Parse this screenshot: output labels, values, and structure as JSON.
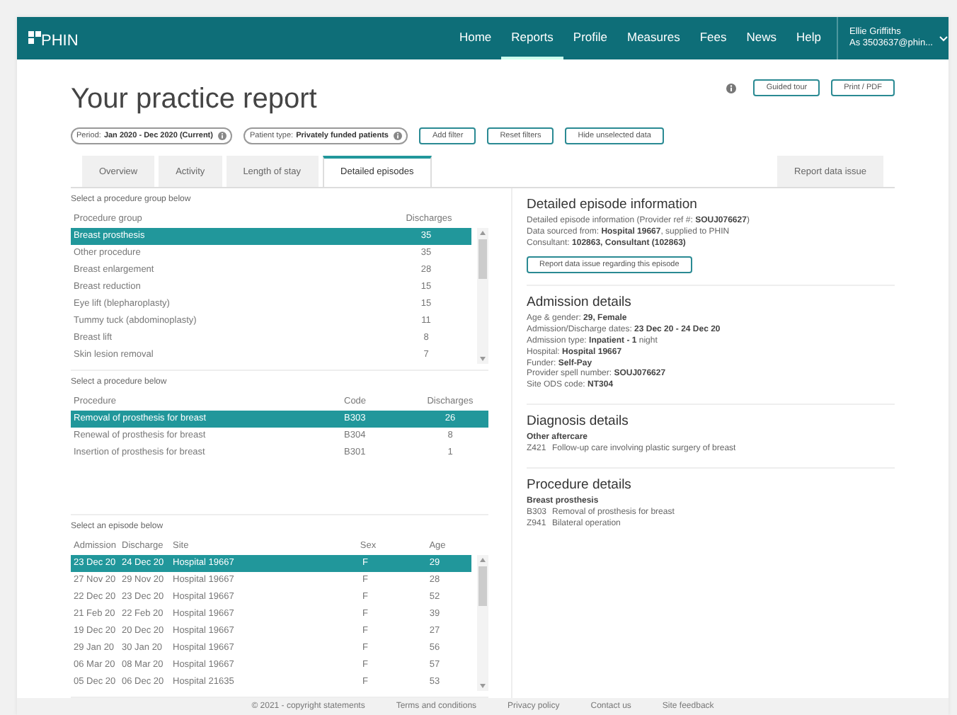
{
  "nav": {
    "logo": "PHIN",
    "items": [
      {
        "label": "Home",
        "selected": false
      },
      {
        "label": "Reports",
        "selected": true
      },
      {
        "label": "Profile",
        "selected": false
      },
      {
        "label": "Measures",
        "selected": false
      },
      {
        "label": "Fees",
        "selected": false
      },
      {
        "label": "News",
        "selected": false
      },
      {
        "label": "Help",
        "selected": false
      }
    ],
    "user": {
      "name": "Ellie Griffiths",
      "account": "As 3503637@phin..."
    }
  },
  "header": {
    "title": "Your practice report",
    "buttons": [
      "Guided tour",
      "Print / PDF"
    ]
  },
  "filters": {
    "chips": [
      {
        "label": "Period:",
        "value": "Jan 2020 - Dec 2020 (Current)"
      },
      {
        "label": "Patient type:",
        "value": "Privately funded patients"
      }
    ],
    "buttons": [
      "Add filter",
      "Reset filters",
      "Hide unselected data"
    ]
  },
  "tabs": [
    {
      "label": "Overview",
      "selected": false
    },
    {
      "label": "Activity",
      "selected": false
    },
    {
      "label": "Length of stay",
      "selected": false
    },
    {
      "label": "Detailed episodes",
      "selected": true
    }
  ],
  "report_issue": "Report data issue",
  "tables": [
    {
      "prompt": "Select a procedure group below",
      "scroll": true,
      "columns": [
        "Procedure group",
        "Discharges"
      ],
      "rows": [
        {
          "cells": [
            "Breast prosthesis",
            "35"
          ],
          "selected": true
        },
        {
          "cells": [
            "Other procedure",
            "35"
          ],
          "selected": false
        },
        {
          "cells": [
            "Breast enlargement",
            "28"
          ],
          "selected": false
        },
        {
          "cells": [
            "Breast reduction",
            "15"
          ],
          "selected": false
        },
        {
          "cells": [
            "Eye lift (blepharoplasty)",
            "15"
          ],
          "selected": false
        },
        {
          "cells": [
            "Tummy tuck (abdominoplasty)",
            "11"
          ],
          "selected": false
        },
        {
          "cells": [
            "Breast lift",
            "8"
          ],
          "selected": false
        },
        {
          "cells": [
            "Skin lesion removal",
            "7"
          ],
          "selected": false
        }
      ]
    },
    {
      "prompt": "Select a procedure below",
      "scroll": false,
      "columns": [
        "Procedure",
        "Code",
        "Discharges"
      ],
      "rows": [
        {
          "cells": [
            "Removal of prosthesis for breast",
            "B303",
            "26"
          ],
          "selected": true
        },
        {
          "cells": [
            "Renewal of prosthesis for breast",
            "B304",
            "8"
          ],
          "selected": false
        },
        {
          "cells": [
            "Insertion of prosthesis for breast",
            "B301",
            "1"
          ],
          "selected": false
        }
      ]
    },
    {
      "prompt": "Select an episode below",
      "scroll": true,
      "columns": [
        "Admission",
        "Discharge",
        "Site",
        "Sex",
        "Age"
      ],
      "rows": [
        {
          "cells": [
            "23 Dec 20",
            "24 Dec 20",
            "Hospital 19667",
            "F",
            "29"
          ],
          "selected": true
        },
        {
          "cells": [
            "27 Nov 20",
            "29 Nov 20",
            "Hospital 19667",
            "F",
            "28"
          ],
          "selected": false
        },
        {
          "cells": [
            "22 Dec 20",
            "23 Dec 20",
            "Hospital 19667",
            "F",
            "52"
          ],
          "selected": false
        },
        {
          "cells": [
            "21 Feb 20",
            "22 Feb 20",
            "Hospital 19667",
            "F",
            "39"
          ],
          "selected": false
        },
        {
          "cells": [
            "19 Dec 20",
            "20 Dec 20",
            "Hospital 19667",
            "F",
            "27"
          ],
          "selected": false
        },
        {
          "cells": [
            "29 Jan 20",
            "30 Jan 20",
            "Hospital 19667",
            "F",
            "56"
          ],
          "selected": false
        },
        {
          "cells": [
            "06 Mar 20",
            "08 Mar 20",
            "Hospital 19667",
            "F",
            "57"
          ],
          "selected": false
        },
        {
          "cells": [
            "05 Dec 20",
            "06 Dec 20",
            "Hospital 21635",
            "F",
            "53"
          ],
          "selected": false
        }
      ]
    }
  ],
  "details": [
    {
      "title": "Detailed episode information",
      "lines": [
        "Detailed episode information (Provider ref #: **SOUJ076627**)",
        "Data sourced from: **Hospital 19667**, supplied to PHIN",
        "Consultant: **102863, Consultant (102863)**"
      ],
      "button": "Report data issue regarding this episode"
    },
    {
      "title": "Admission details",
      "lines": [
        "Age & gender: **29, Female**",
        "Admission/Discharge dates: **23 Dec 20 - 24 Dec 20**",
        "Admission type: **Inpatient - 1** night",
        "Hospital: **Hospital 19667**",
        "Funder: **Self-Pay**",
        "Provider spell number: **SOUJ076627**",
        "Site ODS code: **NT304**"
      ]
    },
    {
      "title": "Diagnosis details",
      "subtitle": "Other aftercare",
      "codes": [
        {
          "code": "Z421",
          "text": "Follow-up care involving plastic surgery of breast"
        }
      ]
    },
    {
      "title": "Procedure details",
      "subtitle": "Breast prosthesis",
      "codes": [
        {
          "code": "B303",
          "text": "Removal of prosthesis for breast"
        },
        {
          "code": "Z941",
          "text": "Bilateral operation"
        }
      ]
    }
  ],
  "footer": [
    "© 2021 - copyright statements",
    "Terms and conditions",
    "Privacy policy",
    "Contact us",
    "Site feedback"
  ]
}
